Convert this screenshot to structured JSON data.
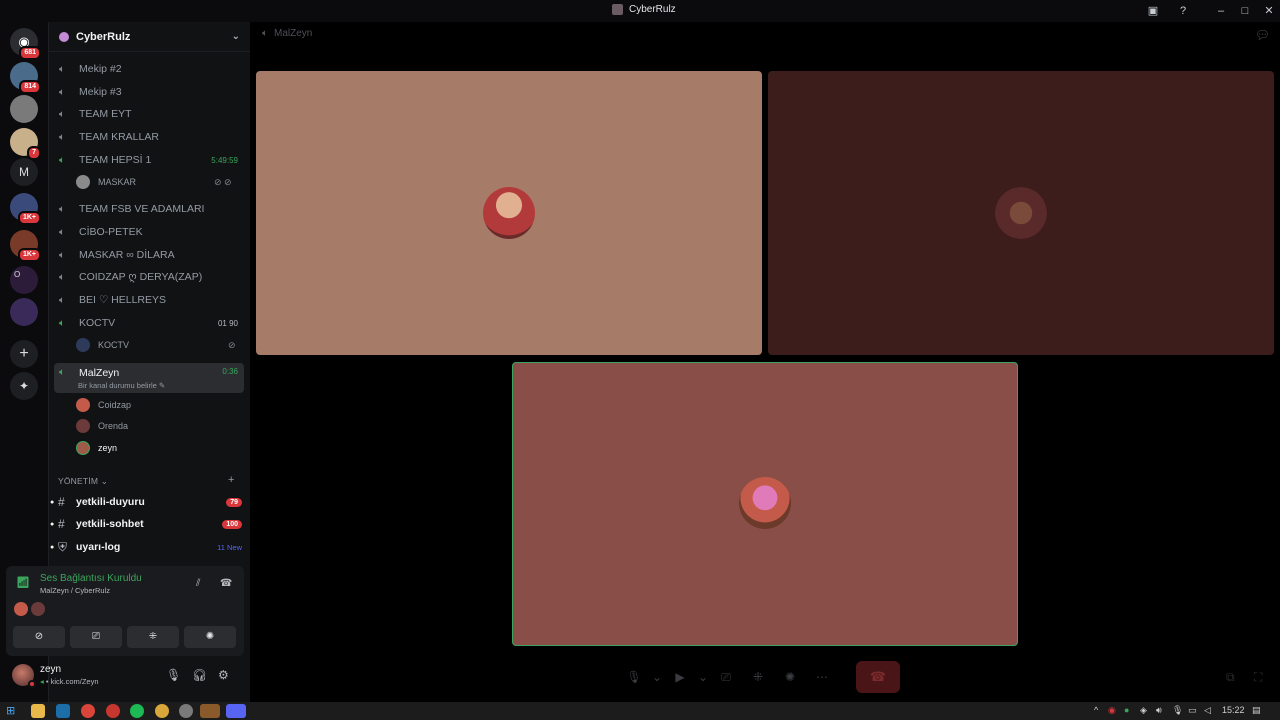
{
  "window": {
    "title": "CyberRulz"
  },
  "rail": {
    "home_badge": "681",
    "servers": [
      {
        "badge": "814",
        "color": "#4a6b8a"
      },
      {
        "badge": "",
        "color": "#7a7a7a"
      },
      {
        "badge": "7",
        "color": "#c8b08a"
      },
      {
        "label": "M",
        "color": "#1e1f22"
      },
      {
        "badge": "1K+",
        "color": "#3a4a7a"
      },
      {
        "badge": "1K+",
        "color": "#7a3a2a"
      },
      {
        "label": "O",
        "color": "#2d1b3a"
      },
      {
        "badge": "",
        "color": "#3a2a5a"
      }
    ]
  },
  "guild": {
    "name": "CyberRulz"
  },
  "channels": {
    "voice": [
      {
        "name": "Mekip #2"
      },
      {
        "name": "Mekip #3"
      },
      {
        "name": "TEAM EYT"
      },
      {
        "name": "TEAM KRALLAR"
      },
      {
        "name": "TEAM HEPSİ 1",
        "meta": "5:49:59"
      },
      {
        "name": "TEAM FSB VE ADAMLARI"
      },
      {
        "name": "CİBO-PETEK"
      },
      {
        "name": "MASKAR ∞ DİLARA"
      },
      {
        "name": "COIDZAP ღ DERYA(ZAP)"
      },
      {
        "name": "BEI ♡ HELLREYS"
      },
      {
        "name": "KOCTV",
        "meta": "01  90"
      }
    ],
    "team_hepsi_member": "MASKAR",
    "koctv_member": "KOCTV",
    "active": {
      "name": "MalZeyn",
      "time": "0:36",
      "status_hint": "Bir kanal durumu belirle"
    },
    "active_members": [
      "Coidzap",
      "Orenda",
      "zeyn"
    ],
    "category": "YÖNETİM",
    "text": [
      {
        "name": "yetkili-duyuru",
        "count": "79"
      },
      {
        "name": "yetkili-sohbet",
        "count": "100"
      },
      {
        "name": "uyarı-log",
        "new": "11 New"
      }
    ]
  },
  "voice_panel": {
    "status": "Ses Bağlantısı Kuruldu",
    "location": "MalZeyn / CyberRulz"
  },
  "user": {
    "name": "zeyn",
    "status": "kick.com/Zeyn"
  },
  "stage": {
    "channel_title": "MalZeyn",
    "tiles": [
      {
        "color": "#a67b68",
        "avatar": "#b33a3a"
      },
      {
        "color": "#3d1c1c",
        "avatar": "#5a2a2a"
      },
      {
        "color": "#8a4e49",
        "avatar": "#d46aa8",
        "speaking": true
      }
    ]
  },
  "taskbar": {
    "time": "15:22"
  }
}
